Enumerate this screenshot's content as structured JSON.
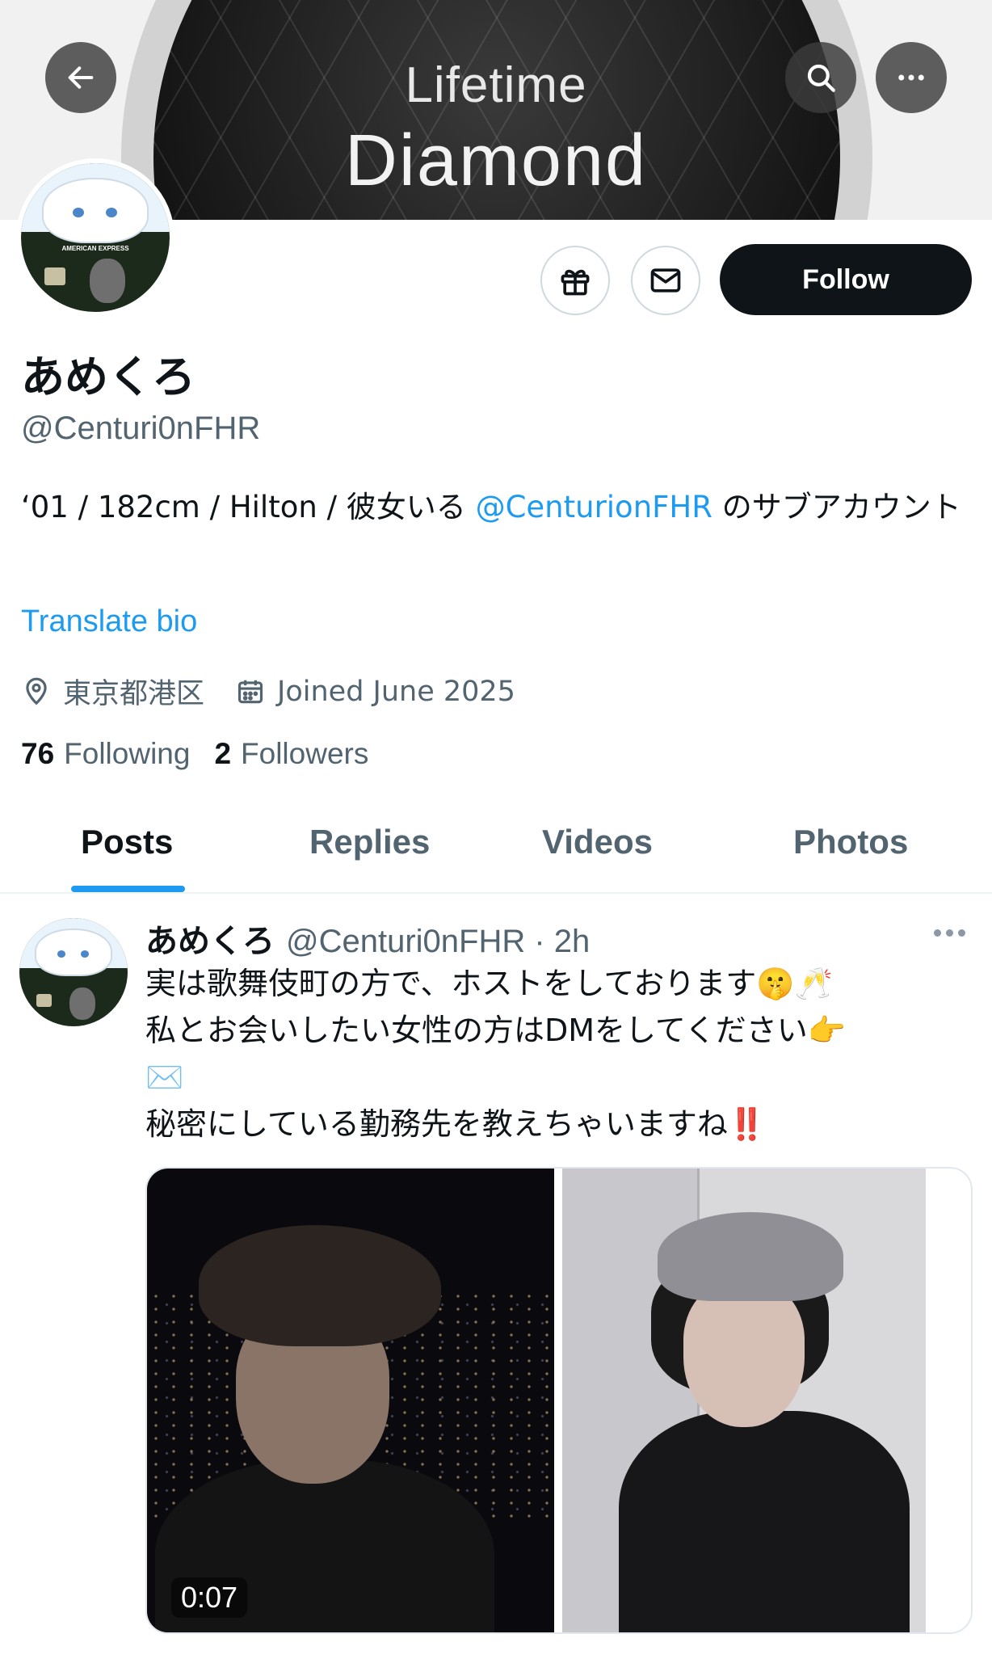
{
  "banner": {
    "line1": "Lifetime",
    "line2": "Diamond"
  },
  "top_nav": {
    "back_icon": "arrow-left-icon",
    "search_icon": "search-icon",
    "more_icon": "more-horizontal-icon"
  },
  "avatar": {
    "card_text": "AMERICAN EXPRESS"
  },
  "actions": {
    "gift_icon": "gift-icon",
    "mail_icon": "mail-icon",
    "follow_label": "Follow"
  },
  "profile": {
    "display_name": "あめくろ",
    "handle": "@Centuri0nFHR",
    "bio_before": "‘01 / 182cm / Hilton / 彼女いる ",
    "bio_mention": "@CenturionFHR",
    "bio_after": " のサブアカウント",
    "translate_label": "Translate bio",
    "location": "東京都港区",
    "joined": "Joined June 2025",
    "following_count": "76",
    "following_label": "Following",
    "followers_count": "2",
    "followers_label": "Followers"
  },
  "tabs": [
    {
      "label": "Posts",
      "active": true
    },
    {
      "label": "Replies",
      "active": false
    },
    {
      "label": "Videos",
      "active": false
    },
    {
      "label": "Photos",
      "active": false
    }
  ],
  "post": {
    "author_name": "あめくろ",
    "author_handle_time": "@Centuri0nFHR · 2h",
    "text": "実は歌舞伎町の方で、ホストをしております🤫🥂\n私とお会いしたい女性の方はDMをしてください👉\n✉️\n秘密にしている勤務先を教えちゃいますね‼️",
    "video_duration": "0:07"
  },
  "colors": {
    "accent": "#1d9bf0",
    "text": "#0f1419",
    "muted": "#536471",
    "follow_bg": "#0f1419"
  }
}
